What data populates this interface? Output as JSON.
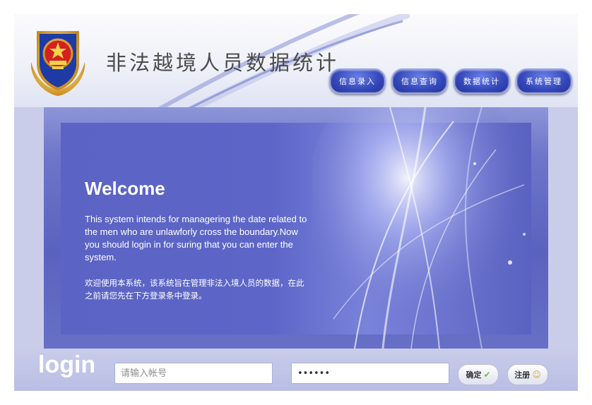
{
  "header": {
    "title": "非法越境人员数据统计",
    "logo_icon": "police-emblem-icon"
  },
  "nav": {
    "items": [
      {
        "label": "信息录入"
      },
      {
        "label": "信息查询"
      },
      {
        "label": "数据统计"
      },
      {
        "label": "系统管理"
      }
    ]
  },
  "welcome": {
    "title": "Welcome",
    "text_en": "This system intends for managering the date related to the men who are unlawforly cross the boundary.Now you should login in for suring that you can enter the system.",
    "text_cn": "欢迎使用本系统，该系统旨在管理非法入境人员的数据，在此之前请您先在下方登录条中登录。"
  },
  "login": {
    "label": "login",
    "account_placeholder": "请输入帐号",
    "password_value": "••••••",
    "confirm_label": "确定",
    "confirm_icon": "check-icon",
    "register_label": "注册",
    "register_icon": "user-icon"
  },
  "colors": {
    "nav_button": "#3447b9",
    "panel": "#5a62bf",
    "frame": "#c9cde9"
  }
}
